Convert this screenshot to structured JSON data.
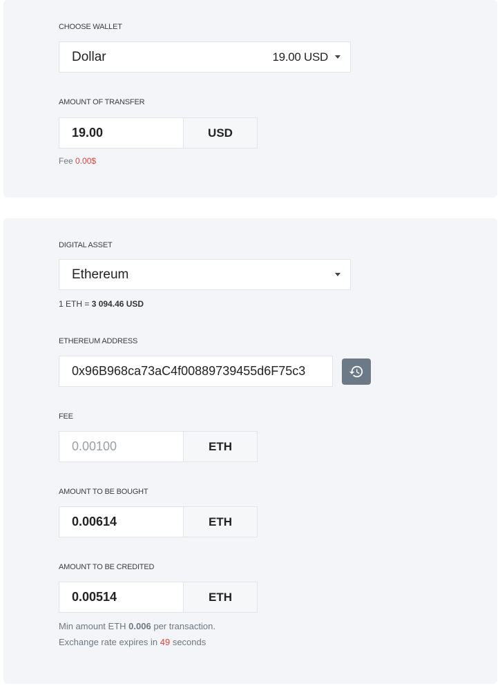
{
  "wallet_section": {
    "choose_wallet_label": "CHOOSE WALLET",
    "wallet_name": "Dollar",
    "wallet_balance": "19.00 USD",
    "amount_label": "AMOUNT OF TRANSFER",
    "amount_value": "19.00",
    "amount_unit": "USD",
    "fee_prefix": "Fee",
    "fee_value": "0.00$"
  },
  "asset_section": {
    "digital_asset_label": "DIGITAL ASSET",
    "asset_name": "Ethereum",
    "rate_prefix": "1 ETH =",
    "rate_value": "3 094.46 USD",
    "address_label": "ETHEREUM ADDRESS",
    "address_value": "0x96B968ca73aC4f00889739455d6F75c3",
    "history_icon": "history-icon",
    "fee_label": "FEE",
    "fee_value": "0.00100",
    "fee_unit": "ETH",
    "bought_label": "AMOUNT TO BE BOUGHT",
    "bought_value": "0.00614",
    "bought_unit": "ETH",
    "credited_label": "AMOUNT TO BE CREDITED",
    "credited_value": "0.00514",
    "credited_unit": "ETH",
    "min_prefix": "Min amount ETH",
    "min_value": "0.006",
    "min_suffix": "per transaction.",
    "expiry_prefix": "Exchange rate expires in",
    "expiry_value": "49",
    "expiry_suffix": "seconds"
  },
  "colors": {
    "card_background": "#f3f5f8",
    "accent_red": "#e0443f",
    "button_gray": "#6c7a87"
  }
}
